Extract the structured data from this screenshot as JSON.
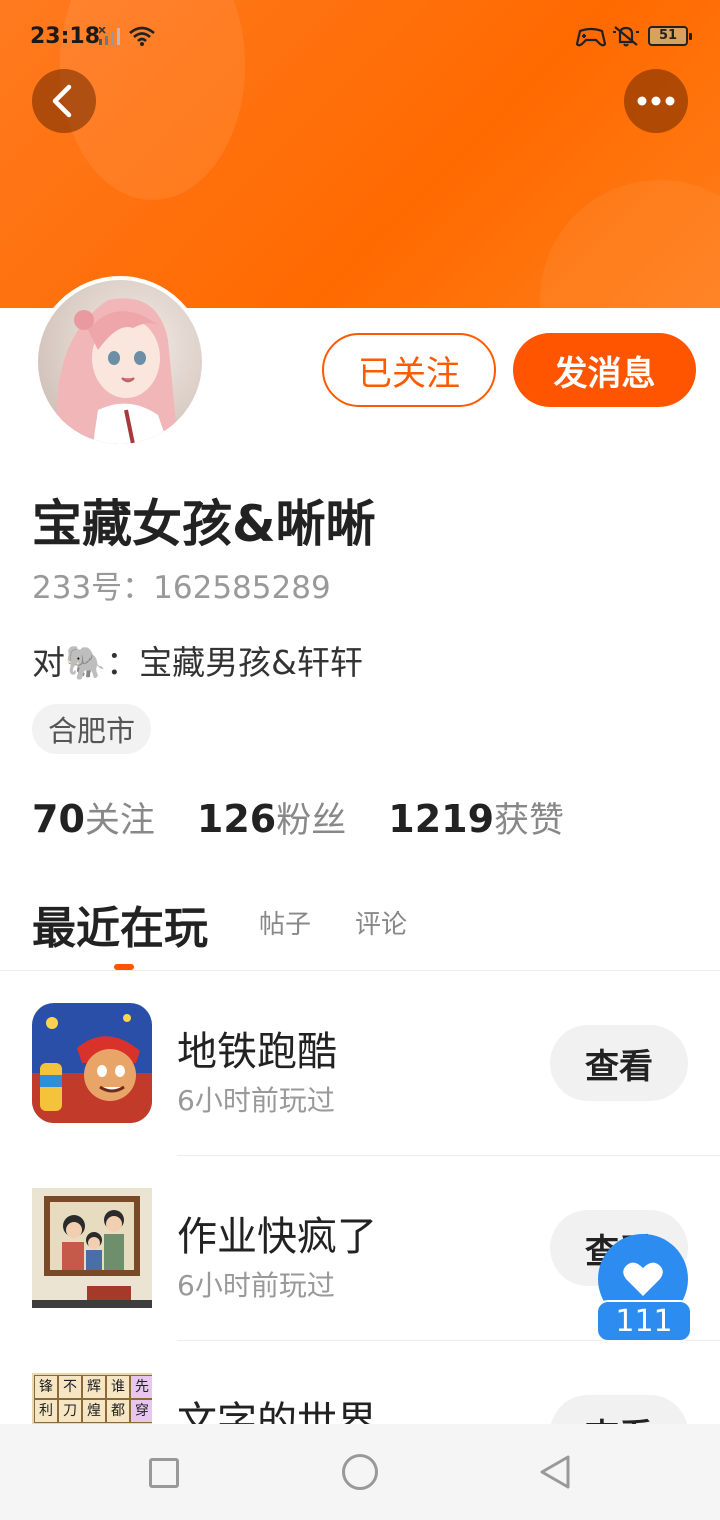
{
  "status_bar": {
    "time": "23:18",
    "battery": "51",
    "icons": [
      "signal-icon",
      "wifi-icon",
      "game-controller-icon",
      "mute-icon",
      "battery-icon"
    ]
  },
  "header": {
    "back_icon": "chevron-left-icon",
    "more_icon": "more-dots-icon",
    "banner_color": "#ff6a00"
  },
  "profile": {
    "name": "宝藏女孩&晰晰",
    "uid": "233号：162585289",
    "partner_prefix": "对",
    "partner_emoji": "🐘",
    "partner_name": "：宝藏男孩&轩轩",
    "location": "合肥市",
    "followed_label": "已关注",
    "message_label": "发消息"
  },
  "stats": [
    {
      "value": "70",
      "label": "关注"
    },
    {
      "value": "126",
      "label": "粉丝"
    },
    {
      "value": "1219",
      "label": "获赞"
    }
  ],
  "tabs": {
    "active": "最近在玩",
    "items": [
      "帖子",
      "评论"
    ]
  },
  "games": [
    {
      "name": "地铁跑酷",
      "time": "6小时前玩过",
      "button": "查看"
    },
    {
      "name": "作业快疯了",
      "time": "6小时前玩过",
      "button": "查看"
    },
    {
      "name": "文字的世界",
      "time": "",
      "button": "查看"
    }
  ],
  "game3_tiles": [
    "锋",
    "不",
    "辉",
    "谁",
    "先",
    "利",
    "刀",
    "煌",
    "都",
    "穿"
  ],
  "like": {
    "count": "111"
  },
  "accent_color": "#ff5500",
  "like_color": "#2d8cf0"
}
